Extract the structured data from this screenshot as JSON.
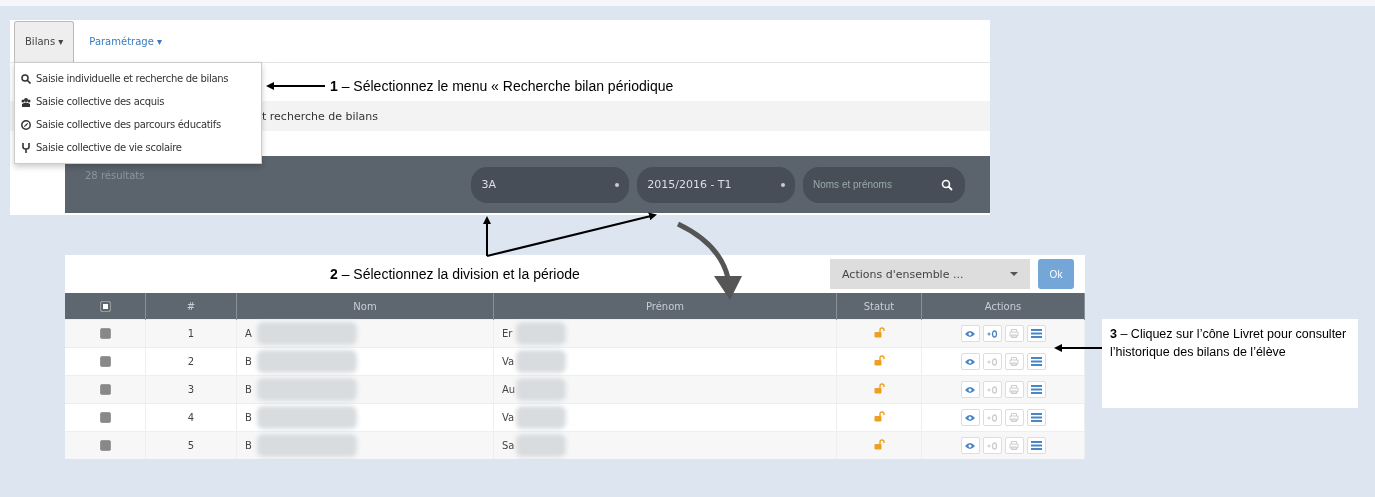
{
  "navbar": {
    "tabs": [
      {
        "label": "Bilans",
        "caret": "▾",
        "selected": true
      },
      {
        "label": "Paramétrage",
        "caret": "▾",
        "selected": false
      }
    ]
  },
  "menu": {
    "items": [
      {
        "kind": "search",
        "label": "Saisie individuelle et recherche de bilans"
      },
      {
        "kind": "group",
        "label": "Saisie collective des acquis"
      },
      {
        "kind": "compass",
        "label": "Saisie collective des parcours éducatifs"
      },
      {
        "kind": "fork",
        "label": "Saisie collective de vie scolaire"
      }
    ]
  },
  "breadcrumb": "t recherche de bilans",
  "search_bar": {
    "count": "28 résultats",
    "division": "3A",
    "period": "2015/2016 - T1",
    "name_placeholder": "Noms et prénoms"
  },
  "annotations": [
    "**1** – Sélectionnez le menu « Recherche bilan périodique",
    "**2** – Sélectionnez la division et la période",
    "**3** – Cliquez sur l’cône Livret pour consulter l’historique des bilans de l’élève"
  ],
  "bulk_actions": {
    "select": "Actions d'ensemble ...",
    "button": "Ok"
  },
  "table": {
    "header_checked": true,
    "columns": [
      "#",
      "Nom",
      "Prénom",
      "Statut",
      "Actions"
    ],
    "rows": [
      {
        "checked": true,
        "number": "1",
        "nom": "A",
        "prenom": "Er",
        "grade_enabled": true
      },
      {
        "checked": true,
        "number": "2",
        "nom": "B",
        "prenom": "Va",
        "grade_enabled": false
      },
      {
        "checked": true,
        "number": "3",
        "nom": "B",
        "prenom": "Au",
        "grade_enabled": false
      },
      {
        "checked": true,
        "number": "4",
        "nom": "B",
        "prenom": "Va",
        "grade_enabled": false
      },
      {
        "checked": true,
        "number": "5",
        "nom": "B",
        "prenom": "Sa",
        "grade_enabled": false
      }
    ]
  }
}
